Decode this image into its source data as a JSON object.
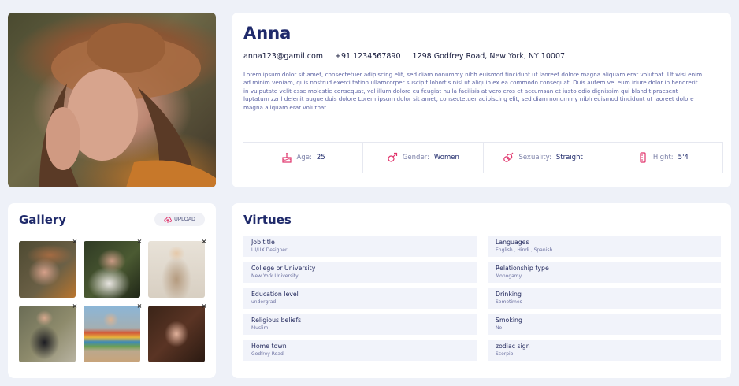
{
  "profile": {
    "name": "Anna",
    "email": "anna123@gamil.com",
    "phone": "+91 1234567890",
    "address": "1298 Godfrey Road, New York, NY 10007",
    "bio": "Lorem ipsum dolor sit amet, consectetuer adipiscing elit, sed diam nonummy nibh euismod tincidunt ut laoreet dolore magna aliquam erat volutpat. Ut wisi enim ad minim veniam, quis nostrud exerci tation ullamcorper suscipit lobortis nisl ut aliquip ex ea commodo consequat. Duis autem vel eum iriure dolor in hendrerit in vulputate velit esse molestie consequat, vel illum dolore eu feugiat nulla facilisis at vero eros et accumsan et iusto odio dignissim qui blandit praesent luptatum zzril delenit augue duis dolore Lorem ipsum dolor sit amet, consectetuer adipiscing elit, sed diam nonummy nibh euismod tincidunt ut laoreet dolore magna aliquam erat volutpat."
  },
  "stats": [
    {
      "label": "Age:",
      "value": "25",
      "icon": "cake-icon"
    },
    {
      "label": "Gender:",
      "value": "Women",
      "icon": "gender-icon"
    },
    {
      "label": "Sexuality:",
      "value": "Straight",
      "icon": "sexuality-icon"
    },
    {
      "label": "Hight:",
      "value": "5'4",
      "icon": "ruler-icon"
    }
  ],
  "gallery": {
    "title": "Gallery",
    "upload_label": "UPLOAD",
    "remove_glyph": "×"
  },
  "virtues": {
    "title": "Virtues",
    "left": [
      {
        "label": "Job title",
        "value": "UI/UX Designer"
      },
      {
        "label": "College or University",
        "value": "New York University"
      },
      {
        "label": "Education level",
        "value": "undergrad"
      },
      {
        "label": "Religious beliefs",
        "value": "Muslim"
      },
      {
        "label": "Home town",
        "value": "Godfrey Road"
      }
    ],
    "right": [
      {
        "label": "Languages",
        "value": "English , Hindi , Spanish"
      },
      {
        "label": "Relationship type",
        "value": "Monogamy"
      },
      {
        "label": "Drinking",
        "value": "Sometimes"
      },
      {
        "label": "Smoking",
        "value": "No"
      },
      {
        "label": "zodiac sign",
        "value": "Scorpio"
      }
    ]
  },
  "colors": {
    "accent": "#e0336b",
    "heading": "#1f2a6b",
    "background": "#eef1f8"
  }
}
